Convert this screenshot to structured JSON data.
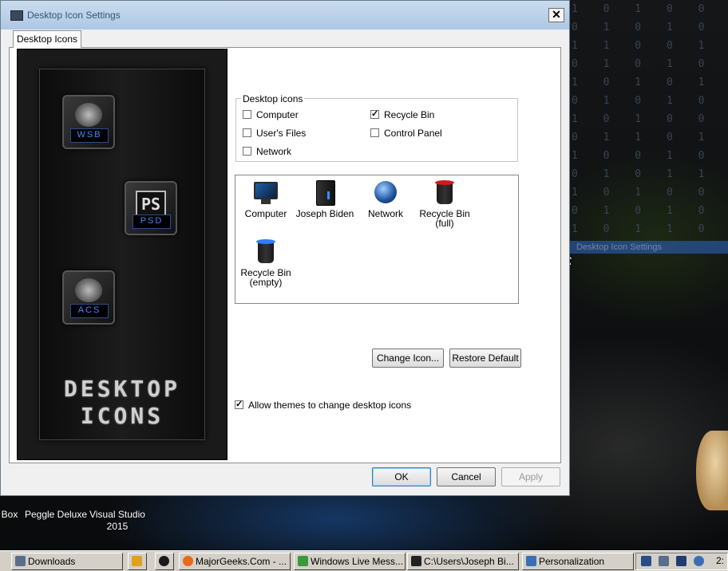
{
  "dialog": {
    "title": "Desktop Icon Settings",
    "close_glyph": "✕",
    "tab_label": "Desktop Icons",
    "preview": {
      "tiles": [
        "WSB",
        "PS",
        "PSD",
        "ACS"
      ],
      "title_line1": "DESKTOP",
      "title_line2": "ICONS"
    },
    "group_label": "Desktop icons",
    "checkboxes": [
      {
        "label": "Computer",
        "checked": false
      },
      {
        "label": "Recycle Bin",
        "checked": true
      },
      {
        "label": "User's Files",
        "checked": false
      },
      {
        "label": "Control Panel",
        "checked": false
      },
      {
        "label": "Network",
        "checked": false
      }
    ],
    "icon_list": [
      {
        "line1": "Computer",
        "line2": "",
        "icon": "computer-monitor-icon"
      },
      {
        "line1": "Joseph Biden",
        "line2": "",
        "icon": "user-files-icon"
      },
      {
        "line1": "Network",
        "line2": "",
        "icon": "network-globe-icon"
      },
      {
        "line1": "Recycle Bin",
        "line2": "(full)",
        "icon": "recycle-bin-full-icon"
      },
      {
        "line1": "Recycle Bin",
        "line2": "(empty)",
        "icon": "recycle-bin-empty-icon"
      }
    ],
    "change_icon_label": "Change Icon...",
    "restore_default_label": "Restore Default",
    "allow_themes_label": "Allow themes to change desktop icons",
    "allow_themes_checked": true,
    "ok_label": "OK",
    "cancel_label": "Cancel",
    "apply_label": "Apply"
  },
  "desktop": {
    "binary_rows": [
      "1 0 1 0 0 1 0 1",
      "0 1 0 1 0 1 0 1",
      "1 1 0 0 1 1 0 1",
      "0 1 0 1 0 1 0 1",
      "1 0 1 0 1 0 1 0",
      "0 1 0 1 0 1 1 1",
      "1 0 1 0 0 1 0 1",
      "0 1 1 0 1 0 1 0",
      "1 0 0 1 0 1 0 1",
      "0 1 0 1 1 0 1 0",
      "1 0 1 0 0 1 0 1",
      "0 1 0 1 0 1 0 1",
      "1 0 1 1 0 1 0 1"
    ],
    "ghost_label": "Desktop Icon Settings",
    "icons": [
      {
        "label": "Box"
      },
      {
        "label": "Peggle Deluxe"
      },
      {
        "label": "Visual Studio 2015"
      }
    ]
  },
  "taskbar": {
    "tasks": [
      {
        "label": "Downloads",
        "color": "#5a6e8a"
      },
      {
        "label": "",
        "color": "#e0a020"
      },
      {
        "label": "",
        "color": "#1a1a1a"
      },
      {
        "label": "MajorGeeks.Com - ...",
        "color": "#e8691b"
      },
      {
        "label": "Windows Live Mess...",
        "color": "#3a9a3a"
      },
      {
        "label": "C:\\Users\\Joseph Bi...",
        "color": "#222222"
      },
      {
        "label": "Personalization",
        "color": "#3a6fb5"
      }
    ],
    "clock": "2:"
  }
}
